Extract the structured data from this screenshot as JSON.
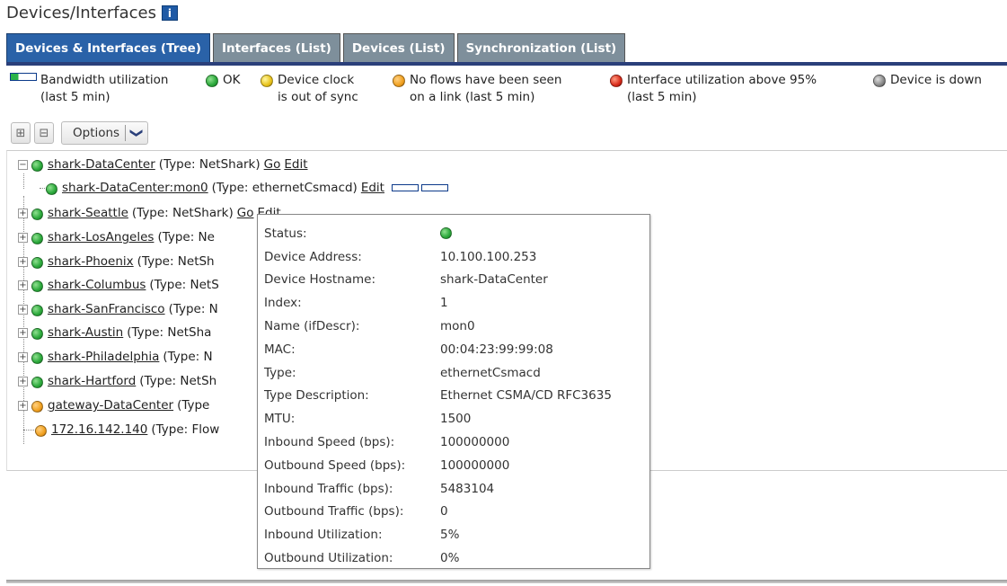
{
  "header": {
    "title": "Devices/Interfaces",
    "info_icon": "i"
  },
  "tabs": [
    {
      "label": "Devices & Interfaces (Tree)",
      "active": true
    },
    {
      "label": "Interfaces (List)",
      "active": false
    },
    {
      "label": "Devices (List)",
      "active": false
    },
    {
      "label": "Synchronization (List)",
      "active": false
    }
  ],
  "legend": {
    "bandwidth": {
      "line1": "Bandwidth utilization",
      "line2": "(last 5 min)"
    },
    "ok": {
      "label": "OK",
      "color": "#2aa83a"
    },
    "clock": {
      "line1": "Device clock",
      "line2": "is out of sync",
      "color": "#e8c21a"
    },
    "noflows": {
      "line1": "No flows have been seen",
      "line2": "on a link (last 5 min)",
      "color": "#f0a020"
    },
    "util95": {
      "line1": "Interface utilization above 95%",
      "line2": "(last 5 min)",
      "color": "#d82a1a"
    },
    "down": {
      "label": "Device is down",
      "color": "#888888"
    }
  },
  "toolbar": {
    "options_label": "Options",
    "expand_icon": "⊞",
    "collapse_icon": "⊟",
    "chevron": "❯"
  },
  "tree": {
    "root": {
      "name": "shark-DataCenter",
      "type": "(Type: NetShark)",
      "go": "Go",
      "edit": "Edit"
    },
    "child": {
      "name": "shark-DataCenter:mon0",
      "type": "(Type: ethernetCsmacd)",
      "edit": "Edit"
    },
    "items": [
      {
        "name": "shark-Seattle",
        "type": "(Type: NetShark)",
        "go": "Go",
        "edit": "Edit",
        "color": "#2aa83a"
      },
      {
        "name": "shark-LosAngeles",
        "type": "(Type: Ne",
        "color": "#2aa83a"
      },
      {
        "name": "shark-Phoenix",
        "type": "(Type: NetSh",
        "color": "#2aa83a"
      },
      {
        "name": "shark-Columbus",
        "type": "(Type: NetS",
        "color": "#2aa83a"
      },
      {
        "name": "shark-SanFrancisco",
        "type": "(Type: N",
        "color": "#2aa83a"
      },
      {
        "name": "shark-Austin",
        "type": "(Type: NetSha",
        "color": "#2aa83a"
      },
      {
        "name": "shark-Philadelphia",
        "type": "(Type: N",
        "color": "#2aa83a"
      },
      {
        "name": "shark-Hartford",
        "type": "(Type: NetSh",
        "color": "#2aa83a"
      },
      {
        "name": "gateway-DataCenter",
        "type": "(Type",
        "color": "#f0a020"
      }
    ],
    "last": {
      "name": "172.16.142.140",
      "type": "(Type: Flow",
      "color": "#f0a020"
    }
  },
  "tooltip": {
    "rows": [
      {
        "key": "Status:",
        "value": ""
      },
      {
        "key": "Device Address:",
        "value": "10.100.100.253"
      },
      {
        "key": "Device Hostname:",
        "value": "shark-DataCenter"
      },
      {
        "key": "Index:",
        "value": "1"
      },
      {
        "key": "Name (ifDescr):",
        "value": "mon0"
      },
      {
        "key": "MAC:",
        "value": "00:04:23:99:99:08"
      },
      {
        "key": "Type:",
        "value": "ethernetCsmacd"
      },
      {
        "key": "Type Description:",
        "value": "Ethernet CSMA/CD RFC3635"
      },
      {
        "key": "MTU:",
        "value": "1500"
      },
      {
        "key": "Inbound Speed (bps):",
        "value": "100000000"
      },
      {
        "key": "Outbound Speed (bps):",
        "value": "100000000"
      },
      {
        "key": "Inbound Traffic (bps):",
        "value": "5483104"
      },
      {
        "key": "Outbound Traffic (bps):",
        "value": "0"
      },
      {
        "key": "Inbound Utilization:",
        "value": "5%"
      },
      {
        "key": "Outbound Utilization:",
        "value": "0%"
      }
    ],
    "status_color": "#2aa83a"
  }
}
